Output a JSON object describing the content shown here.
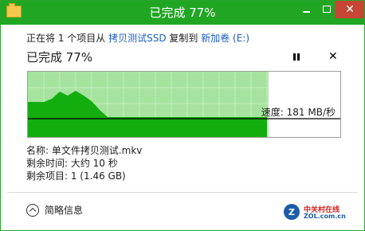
{
  "window": {
    "title": "已完成 77%",
    "controls": {
      "minimize": "",
      "maximize": "",
      "close": "✕"
    }
  },
  "copy": {
    "prefix": "正在将 1 个项目从 ",
    "source": "拷贝测试SSD",
    "middle": " 复制到 ",
    "destination": "新加卷 (E:)"
  },
  "progress": {
    "label": "已完成 77%",
    "percent": 77
  },
  "graph": {
    "speed_label": "速度: 181 MB/秒",
    "colors": {
      "completed_area": "#a6e39f",
      "speed_fill": "#13ad10",
      "speed_line": "#000000",
      "border": "#9e9e9e"
    }
  },
  "details": {
    "name": "名称: 单文件拷贝测试.mkv",
    "time_remaining": "剩余时间: 大约 10 秒",
    "items_remaining": "剩余项目: 1 (1.46 GB)"
  },
  "footer": {
    "less_info": "简略信息"
  },
  "watermark": {
    "line1": "中关村在线",
    "line2": "ZOL.com.cn"
  },
  "icons": {
    "app": "folder-icon",
    "pause": "pause-icon",
    "cancel": "close-icon",
    "less_info": "chevron-up-icon"
  },
  "colors": {
    "titlebar": "#21a624",
    "close_button": "#c74535",
    "link": "#1c5ec2"
  }
}
